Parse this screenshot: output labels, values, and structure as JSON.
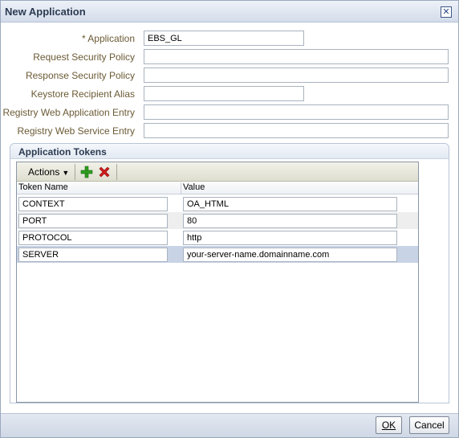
{
  "dialog": {
    "title": "New Application",
    "close_glyph": "✕"
  },
  "form": {
    "application": {
      "required_mark": "*",
      "label": "Application",
      "value": "EBS_GL"
    },
    "request_security_policy": {
      "label": "Request Security Policy",
      "value": ""
    },
    "response_security_policy": {
      "label": "Response Security Policy",
      "value": ""
    },
    "keystore_recipient_alias": {
      "label": "Keystore Recipient Alias",
      "value": ""
    },
    "registry_web_application_entry": {
      "label": "Registry Web Application Entry",
      "value": ""
    },
    "registry_web_service_entry": {
      "label": "Registry Web Service Entry",
      "value": ""
    }
  },
  "tokens": {
    "section_title": "Application Tokens",
    "actions_label": "Actions",
    "columns": [
      "Token Name",
      "Value"
    ],
    "rows": [
      {
        "name": "CONTEXT",
        "value": "OA_HTML"
      },
      {
        "name": "PORT",
        "value": "80"
      },
      {
        "name": "PROTOCOL",
        "value": "http"
      },
      {
        "name": "SERVER",
        "value": "your-server-name.domainname.com"
      }
    ],
    "add_icon": "add-icon",
    "delete_icon": "delete-icon"
  },
  "footer": {
    "ok_label": "OK",
    "cancel_label": "Cancel"
  },
  "colors": {
    "label_text": "#6b5a35",
    "title_text": "#2b3a52",
    "add_green": "#2e9e1e",
    "delete_red": "#d11a1a",
    "selected_row": "#c8d3e6",
    "alt_row": "#eeeeee"
  }
}
